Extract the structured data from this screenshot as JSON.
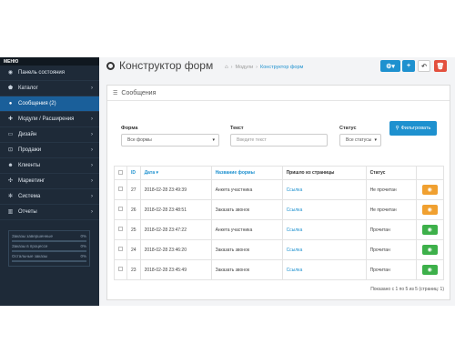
{
  "sidebar": {
    "header": "МЕНЮ",
    "items": [
      {
        "label": "Панель состояния",
        "icon": "dashboard-icon",
        "glyph": "◉",
        "chevron": false
      },
      {
        "label": "Каталог",
        "icon": "tag-icon",
        "glyph": "⬟",
        "chevron": true
      },
      {
        "label": "Сообщения (2)",
        "icon": "chat-icon",
        "glyph": "●",
        "chevron": false,
        "active": true
      },
      {
        "label": "Модули / Расширения",
        "icon": "puzzle-icon",
        "glyph": "✚",
        "chevron": true
      },
      {
        "label": "Дизайн",
        "icon": "monitor-icon",
        "glyph": "▭",
        "chevron": true
      },
      {
        "label": "Продажи",
        "icon": "cart-icon",
        "glyph": "⊡",
        "chevron": true
      },
      {
        "label": "Клиенты",
        "icon": "user-icon",
        "glyph": "☻",
        "chevron": true
      },
      {
        "label": "Маркетинг",
        "icon": "share-icon",
        "glyph": "✣",
        "chevron": true
      },
      {
        "label": "Система",
        "icon": "cog-icon",
        "glyph": "✻",
        "chevron": true
      },
      {
        "label": "Отчеты",
        "icon": "bar-chart-icon",
        "glyph": "▥",
        "chevron": true
      }
    ],
    "stats": [
      {
        "label": "Заказы завершенные",
        "pct": "0%",
        "value": 0
      },
      {
        "label": "Заказы в процессе",
        "pct": "0%",
        "value": 0
      },
      {
        "label": "Остальные заказы",
        "pct": "0%",
        "value": 0
      }
    ]
  },
  "header": {
    "title": "Конструктор форм",
    "breadcrumb": [
      "Модули",
      "Конструктор форм"
    ],
    "buttons": {
      "gear": "⚙▾",
      "plus": "+",
      "back": "↶",
      "delete": "🗑"
    }
  },
  "panel": {
    "title": "Сообщения",
    "filter": {
      "form_label": "Форма",
      "form_value": "Все формы",
      "text_label": "Текст",
      "text_placeholder": "Введите текст",
      "status_label": "Статус",
      "status_value": "Все статусы",
      "button": "Фильтровать"
    },
    "table": {
      "headers": {
        "id": "ID",
        "date": "Дата ▾",
        "form": "Название формы",
        "source": "Пришло из страницы",
        "status": "Статус"
      },
      "rows": [
        {
          "id": "27",
          "date": "2018-02-28 23:49:39",
          "form": "Анкета участника",
          "source": "Ссылка",
          "status": "Не прочитан",
          "btn": "orange"
        },
        {
          "id": "26",
          "date": "2018-02-28 23:48:51",
          "form": "Заказать звонок",
          "source": "Ссылка",
          "status": "Не прочитан",
          "btn": "orange"
        },
        {
          "id": "25",
          "date": "2018-02-28 23:47:22",
          "form": "Анкета участника",
          "source": "Ссылка",
          "status": "Прочитан",
          "btn": "green"
        },
        {
          "id": "24",
          "date": "2018-02-28 23:46:20",
          "form": "Заказать звонок",
          "source": "Ссылка",
          "status": "Прочитан",
          "btn": "green"
        },
        {
          "id": "23",
          "date": "2018-02-28 23:45:49",
          "form": "Заказать звонок",
          "source": "Ссылка",
          "status": "Прочитан",
          "btn": "green"
        }
      ]
    },
    "pagination_text": "Показано с 1 по 5 из 5 (страниц: 1)"
  },
  "colors": {
    "accent": "#1e91cf",
    "sidebar": "#1e2a38",
    "danger": "#e3503e",
    "warning": "#f0a030",
    "success": "#3db04a"
  }
}
